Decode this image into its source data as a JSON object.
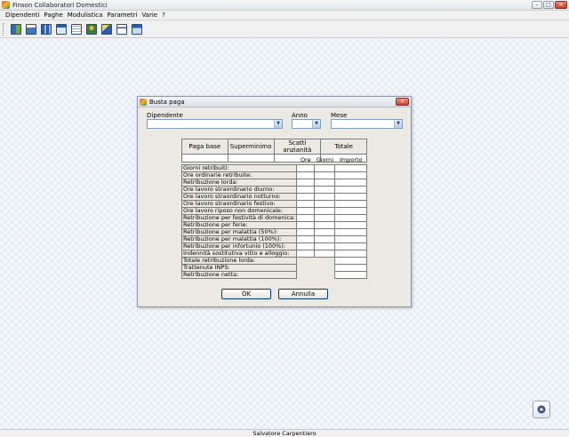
{
  "window": {
    "title": "Finson Collaboratori Domestici"
  },
  "menu": [
    "Dipendenti",
    "Paghe",
    "Modulistica",
    "Parametri",
    "Varie",
    "?"
  ],
  "toolbar": [
    "tool-1",
    "tool-2",
    "tool-3",
    "tool-4",
    "tool-5",
    "tool-6",
    "tool-7",
    "tool-8",
    "tool-9"
  ],
  "dialog": {
    "title": "Busta paga",
    "close_glyph": "✕",
    "fields": {
      "dipendente_label": "Dipendente",
      "anno_label": "Anno",
      "mese_label": "Mese",
      "dipendente_value": "",
      "anno_value": "",
      "mese_value": ""
    },
    "summary_headers": [
      "Paga base",
      "Superminimo",
      "Scatti anzianità",
      "Totale"
    ],
    "grid_headers": [
      "Ore",
      "Giorni",
      "Importo"
    ],
    "rows": [
      "Giorni retribuiti:",
      "Ore ordinarie retribuite:",
      "Retribuzione lorda:",
      "Ore lavoro straordinario diurno:",
      "Ore lavoro straordinario notturno:",
      "Ore lavoro straordinario festivo:",
      "Ore lavoro riposo non domenicale:",
      "Retribuzione per festività di domenica:",
      "Retribuzione per ferie:",
      "Retribuzione per malattia (50%):",
      "Retribuzione per malattia (100%):",
      "Retribuzione per infortunio (100%):",
      "Indennità sostitutiva vitto e alloggio:",
      "Totale retribuzione lorda:",
      "Trattenute INPS:",
      "Retribuzione netta:"
    ],
    "ok_label": "OK",
    "cancel_label": "Annulla"
  },
  "status": {
    "user": "Salvatore Carpentiero"
  },
  "winbtn_glyphs": {
    "min": "–",
    "max": "□",
    "close": "✕"
  }
}
